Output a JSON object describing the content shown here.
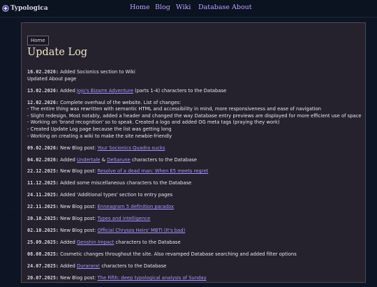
{
  "site": {
    "name": "Typologica"
  },
  "nav": [
    "Home",
    "Blog",
    "Wiki",
    "Database",
    "About"
  ],
  "breadcrumb": "Home",
  "page_title": "Update Log",
  "entries": [
    {
      "date": "16.02.2026:",
      "lines": [
        [
          {
            "t": " Added Socionics section to Wiki"
          }
        ],
        [
          {
            "t": "Updated About page"
          }
        ]
      ]
    },
    {
      "date": "13.02.2026:",
      "lines": [
        [
          {
            "t": " Added "
          },
          {
            "t": "Jojo's Bizarre Adventure",
            "link": true
          },
          {
            "t": " (parts 1-4) characters to the Database"
          }
        ]
      ]
    },
    {
      "date": "12.02.2026:",
      "lines": [
        [
          {
            "t": " Complete overhaul of the website. List of changes:"
          }
        ],
        [
          {
            "t": "- The entire thing was rewritten with semantic HTML and accessibility in mind, more responsiveness and ease of navigation"
          }
        ],
        [
          {
            "t": "- Slight redesign. Most notably, added a header and changed the way Database entry previews are displayed for more efficient use of space"
          }
        ],
        [
          {
            "t": "- Working on 'brand recognition' so to speak. Created a logo and added OG meta tags (praying they work)"
          }
        ],
        [
          {
            "t": "- Created Update Log page because the list was getting long"
          }
        ],
        [
          {
            "t": "- Working on creating a wiki to make the site newbie-friendly"
          }
        ]
      ]
    },
    {
      "date": "09.02.2026:",
      "lines": [
        [
          {
            "t": " New Blog post: "
          },
          {
            "t": "Your Socionics Quadra sucks",
            "link": true
          }
        ]
      ]
    },
    {
      "date": "04.02.2026:",
      "lines": [
        [
          {
            "t": " Added "
          },
          {
            "t": "Undertale",
            "link": true
          },
          {
            "t": " & "
          },
          {
            "t": "Deltarune",
            "link": true
          },
          {
            "t": " characters to the Database"
          }
        ]
      ]
    },
    {
      "date": "22.12.2025:",
      "lines": [
        [
          {
            "t": " New Blog post: "
          },
          {
            "t": "Resolve of a dead man: When E5 meets regret",
            "link": true
          }
        ]
      ]
    },
    {
      "date": "11.12.2025:",
      "lines": [
        [
          {
            "t": " Added some miscellaneous characters to the Database"
          }
        ]
      ]
    },
    {
      "date": "24.11.2025:",
      "lines": [
        [
          {
            "t": " Added 'Additional types' section to entry pages"
          }
        ]
      ]
    },
    {
      "date": "22.11.2025:",
      "lines": [
        [
          {
            "t": " New Blog post: "
          },
          {
            "t": "Enneagram 5 definition paradox",
            "link": true
          }
        ]
      ]
    },
    {
      "date": "20.10.2025:",
      "lines": [
        [
          {
            "t": " New Blog post: "
          },
          {
            "t": "Types and intelligence",
            "link": true
          }
        ]
      ]
    },
    {
      "date": "02.10.2025:",
      "lines": [
        [
          {
            "t": " New Blog post: "
          },
          {
            "t": "Official Chrysos Heirs' MBTI (It's bad)",
            "link": true
          }
        ]
      ]
    },
    {
      "date": "25.09.2025:",
      "lines": [
        [
          {
            "t": " Added "
          },
          {
            "t": "Genshin Impact",
            "link": true
          },
          {
            "t": " characters to the Database"
          }
        ]
      ]
    },
    {
      "date": "08.08.2025:",
      "lines": [
        [
          {
            "t": " Cosmetic changes throughout the site. Also revamped Database searching and added filter options"
          }
        ]
      ]
    },
    {
      "date": "24.07.2025:",
      "lines": [
        [
          {
            "t": " Added "
          },
          {
            "t": "Durarara!",
            "link": true
          },
          {
            "t": " characters to the Database"
          }
        ]
      ]
    },
    {
      "date": "20.07.2025:",
      "lines": [
        [
          {
            "t": " New Blog post: "
          },
          {
            "t": "The Fifth: deep typological analysis of Sunday",
            "link": true
          }
        ]
      ]
    }
  ],
  "colors": {
    "background": "#0d1524",
    "panel": "#25222e",
    "link": "#a995ff",
    "title": "#efe7c8"
  },
  "icons": {
    "logo": "typologica-logo-icon"
  }
}
